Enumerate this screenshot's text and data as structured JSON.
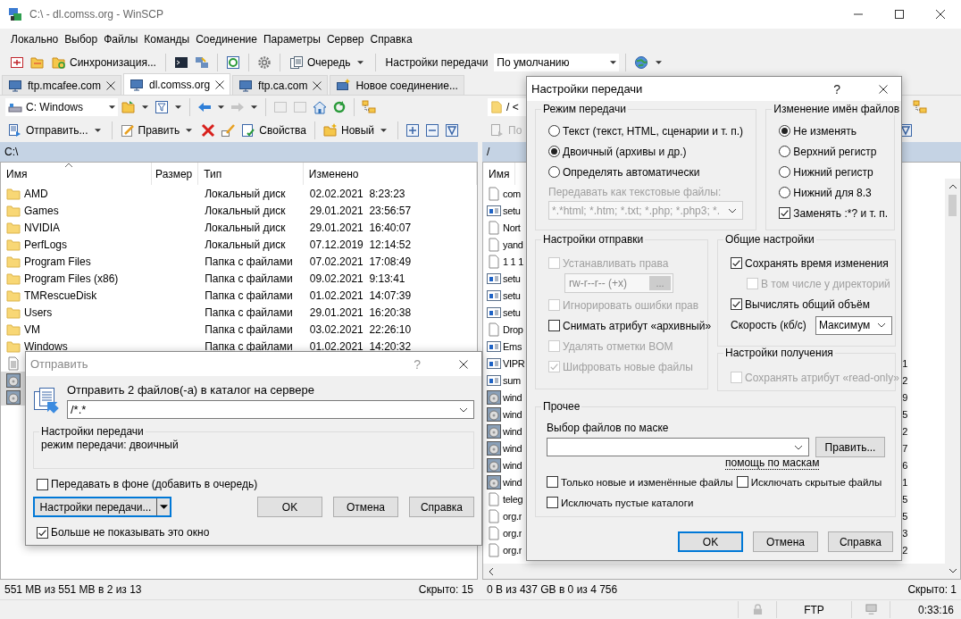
{
  "window": {
    "title": "C:\\ - dl.comss.org - WinSCP"
  },
  "menu": [
    "Локально",
    "Выбор",
    "Файлы",
    "Команды",
    "Соединение",
    "Параметры",
    "Сервер",
    "Справка"
  ],
  "toolbar": {
    "sync_label": "Синхронизация...",
    "queue_label": "Очередь",
    "transfer_settings_label": "Настройки передачи",
    "transfer_preset": "По умолчанию"
  },
  "tabs": [
    {
      "label": "ftp.mcafee.com",
      "kind": "site",
      "selected": false
    },
    {
      "label": "dl.comss.org",
      "kind": "site",
      "selected": true
    },
    {
      "label": "ftp.ca.com",
      "kind": "site",
      "selected": false
    },
    {
      "label": "Новое соединение...",
      "kind": "new",
      "selected": false
    }
  ],
  "left_panel": {
    "drive": "C: Windows",
    "send_label": "Отправить...",
    "edit_label": "Править",
    "properties_label": "Свойства",
    "new_label": "Новый",
    "path": "C:\\",
    "columns": [
      "Имя",
      "Размер",
      "Тип",
      "Изменено"
    ],
    "rows": [
      {
        "name": "AMD",
        "kind": "folder",
        "type": "Локальный диск",
        "modified": "02.02.2021  8:23:23",
        "selected": false
      },
      {
        "name": "Games",
        "kind": "folder",
        "type": "Локальный диск",
        "modified": "29.01.2021  23:56:57",
        "selected": false
      },
      {
        "name": "NVIDIA",
        "kind": "folder",
        "type": "Локальный диск",
        "modified": "29.01.2021  16:40:07",
        "selected": false
      },
      {
        "name": "PerfLogs",
        "kind": "folder",
        "type": "Локальный диск",
        "modified": "07.12.2019  12:14:52",
        "selected": false
      },
      {
        "name": "Program Files",
        "kind": "folder",
        "type": "Папка с файлами",
        "modified": "07.02.2021  17:08:49",
        "selected": false
      },
      {
        "name": "Program Files (x86)",
        "kind": "folder",
        "type": "Папка с файлами",
        "modified": "09.02.2021  9:13:41",
        "selected": false
      },
      {
        "name": "TMRescueDisk",
        "kind": "folder",
        "type": "Папка с файлами",
        "modified": "01.02.2021  14:07:39",
        "selected": false
      },
      {
        "name": "Users",
        "kind": "folder",
        "type": "Папка с файлами",
        "modified": "29.01.2021  16:20:38",
        "selected": false
      },
      {
        "name": "VM",
        "kind": "folder",
        "type": "Папка с файлами",
        "modified": "03.02.2021  22:26:10",
        "selected": false
      },
      {
        "name": "Windows",
        "kind": "folder",
        "type": "Папка с файлами",
        "modified": "01.02.2021  14:20:32",
        "selected": false
      },
      {
        "kind": "document",
        "selected": false
      },
      {
        "kind": "disc",
        "selected": true
      },
      {
        "kind": "disc",
        "selected": true
      }
    ],
    "status": "551 MB из 551 MB в 2 из 13",
    "hidden": "Скрыто: 15"
  },
  "right_panel": {
    "path_field": "/ <",
    "action_label": "По",
    "path": "/",
    "columns": [
      "Имя"
    ],
    "rows": [
      {
        "name": "com",
        "kind": "file"
      },
      {
        "name": "setu",
        "kind": "setup"
      },
      {
        "name": "Nort",
        "kind": "file"
      },
      {
        "name": "yand",
        "kind": "file"
      },
      {
        "name": "1 1 1",
        "kind": "file"
      },
      {
        "name": "setu",
        "kind": "setup"
      },
      {
        "name": "setu",
        "kind": "setup"
      },
      {
        "name": "setu",
        "kind": "setup"
      },
      {
        "name": "Drop",
        "kind": "file"
      },
      {
        "name": "Ems",
        "kind": "setup"
      },
      {
        "name": "VIPR",
        "kind": "setup",
        "column_2": "1"
      },
      {
        "name": "sum",
        "kind": "setup",
        "column_2": "2"
      },
      {
        "name": "wind",
        "kind": "disc",
        "column_2": "9"
      },
      {
        "name": "wind",
        "kind": "disc",
        "column_2": "5"
      },
      {
        "name": "wind",
        "kind": "disc",
        "column_2": "2"
      },
      {
        "name": "wind",
        "kind": "disc",
        "column_2": "7"
      },
      {
        "name": "wind",
        "kind": "disc",
        "column_2": "6"
      },
      {
        "name": "wind",
        "kind": "disc",
        "column_2": "1"
      },
      {
        "name": "teleg",
        "kind": "file",
        "column_2": "5"
      },
      {
        "name": "org.r",
        "kind": "file",
        "column_2": "5"
      },
      {
        "name": "org.r",
        "kind": "file",
        "column_2": "3"
      },
      {
        "name": "org.r",
        "kind": "file",
        "column_2": "2"
      }
    ],
    "status": "0 B из 437 GB в 0 из 4 756",
    "hidden": "Скрыто: 1"
  },
  "status_bar": {
    "protocol": "FTP",
    "elapsed": "0:33:16"
  },
  "send_dialog": {
    "title": "Отправить",
    "help": "?",
    "prompt": "Отправить 2 файлов(-а) в каталог на сервере",
    "target": "/*.*",
    "settings_title": "Настройки передачи",
    "settings_summary": "режим передачи: двоичный",
    "background": {
      "label": "Передавать в фоне (добавить в очередь)",
      "checked": false
    },
    "settings_button": "Настройки передачи...",
    "buttons": [
      {
        "label": "OK",
        "default": false
      },
      {
        "label": "Отмена",
        "default": false
      },
      {
        "label": "Справка",
        "default": false
      }
    ],
    "dont_show": {
      "label": "Больше не показывать это окно",
      "checked": true
    }
  },
  "transfer_dialog": {
    "title": "Настройки передачи",
    "help": "?",
    "mode_group": {
      "title": "Режим передачи",
      "options": [
        {
          "label": "Текст (текст, HTML, сценарии и т. п.)",
          "selected": false
        },
        {
          "label": "Двоичный (архивы и др.)",
          "selected": true
        },
        {
          "label": "Определять автоматически",
          "selected": false
        }
      ],
      "text_files_label": "Передавать как текстовые файлы:",
      "text_files_value": "*.*html; *.htm; *.txt; *.php; *.php3; *."
    },
    "rename_group": {
      "title": "Изменение имён файлов",
      "options": [
        {
          "label": "Не изменять",
          "selected": true
        },
        {
          "label": "Верхний регистр",
          "selected": false
        },
        {
          "label": "Нижний регистр",
          "selected": false
        },
        {
          "label": "Нижний для 8.3",
          "selected": false
        }
      ],
      "replace": {
        "label": "Заменять :*? и т. п.",
        "checked": true
      }
    },
    "upload_group": {
      "title": "Настройки отправки",
      "items": [
        {
          "kind": "checkbox",
          "label": "Устанавливать права",
          "checked": false,
          "disabled": true
        },
        {
          "kind": "permissions",
          "value": "rw-r--r-- (+x)",
          "button": "...",
          "disabled": true
        },
        {
          "kind": "checkbox",
          "label": "Игнорировать ошибки прав",
          "checked": false,
          "disabled": true
        },
        {
          "kind": "checkbox",
          "label": "Снимать атрибут «архивный»",
          "checked": false,
          "disabled": false
        },
        {
          "kind": "checkbox",
          "label": "Удалять отметки BOM",
          "checked": false,
          "disabled": true
        },
        {
          "kind": "checkbox",
          "label": "Шифровать новые файлы",
          "checked": true,
          "disabled": true
        }
      ]
    },
    "common_group": {
      "title": "Общие настройки",
      "items": [
        {
          "kind": "checkbox",
          "label": "Сохранять время изменения",
          "checked": true,
          "disabled": false
        },
        {
          "kind": "subcheckbox",
          "label": "В том числе у директорий",
          "checked": false,
          "disabled": true
        },
        {
          "kind": "checkbox",
          "label": "Вычислять общий объём",
          "checked": true,
          "disabled": false
        },
        {
          "kind": "select",
          "label": "Скорость (кб/с)",
          "value": "Максимум"
        }
      ]
    },
    "download_group": {
      "title": "Настройки получения",
      "items": [
        {
          "kind": "checkbox",
          "label": "Сохранять атрибут «read-only»",
          "checked": false,
          "disabled": true
        }
      ]
    },
    "other_group": {
      "title": "Прочее",
      "mask_label": "Выбор файлов по маске",
      "edit_button": "Править...",
      "mask_help": "помощь по маскам",
      "options": [
        {
          "label": "Только новые и изменённые файлы",
          "checked": false
        },
        {
          "label": "Исключать скрытые файлы",
          "checked": false
        },
        {
          "label": "Исключать пустые каталоги",
          "checked": false
        }
      ]
    },
    "buttons": [
      {
        "label": "OK",
        "default": true
      },
      {
        "label": "Отмена",
        "default": false
      },
      {
        "label": "Справка",
        "default": false
      }
    ]
  }
}
